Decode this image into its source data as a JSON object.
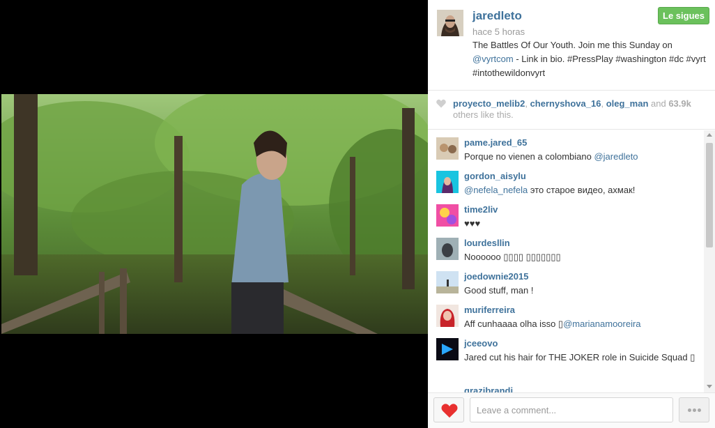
{
  "post": {
    "username": "jaredleto",
    "time_ago": "hace 5 horas",
    "follow_label": "Le sigues",
    "caption": {
      "part1": "The Battles Of Our Youth. Join me this Sunday on ",
      "mention": "@vyrtcom",
      "part2": " - Link in bio. #PressPlay #washington #dc #vyrt #intothewildonvyrt"
    }
  },
  "likes": {
    "user1": "proyecto_melib2",
    "sep1": ", ",
    "user2": "chernyshova_16",
    "sep2": ", ",
    "user3": "oleg_man",
    "and": " and ",
    "count": "63.9k",
    "suffix": " others like this."
  },
  "comments": [
    {
      "user": "pame.jared_65",
      "text": "Porque no vienen a colombiano ",
      "mention": "@jaredleto",
      "avatar": "beige"
    },
    {
      "user": "gordon_aisylu",
      "text": " это старое видео, ахмак!",
      "mention_first": "@nefela_nefela",
      "avatar": "cyan"
    },
    {
      "user": "time2liv",
      "text": "♥♥♥",
      "avatar": "pink"
    },
    {
      "user": "lourdesllin",
      "text": "Noooooo ▯▯▯▯ ▯▯▯▯▯▯▯",
      "avatar": "gray"
    },
    {
      "user": "joedownie2015",
      "text": "Good stuff, man !",
      "avatar": "sky"
    },
    {
      "user": "muriferreira",
      "text": "Aff cunhaaaa olha isso ▯",
      "mention": "@marianamooreira",
      "avatar": "red"
    },
    {
      "user": "jceeovo",
      "text": "Jared cut his hair for THE JOKER role in Suicide Squad ▯",
      "avatar": "blue"
    },
    {
      "user": "grazibrandi",
      "text": "",
      "avatar": "dark"
    }
  ],
  "footer": {
    "comment_placeholder": "Leave a comment..."
  },
  "colors": {
    "link": "#3f729b",
    "follow_green": "#6bc15c",
    "heart_red": "#e8302f"
  },
  "icons": {
    "like_small": "heart-icon",
    "like_button": "red-heart-icon",
    "more": "ellipsis-icon"
  }
}
